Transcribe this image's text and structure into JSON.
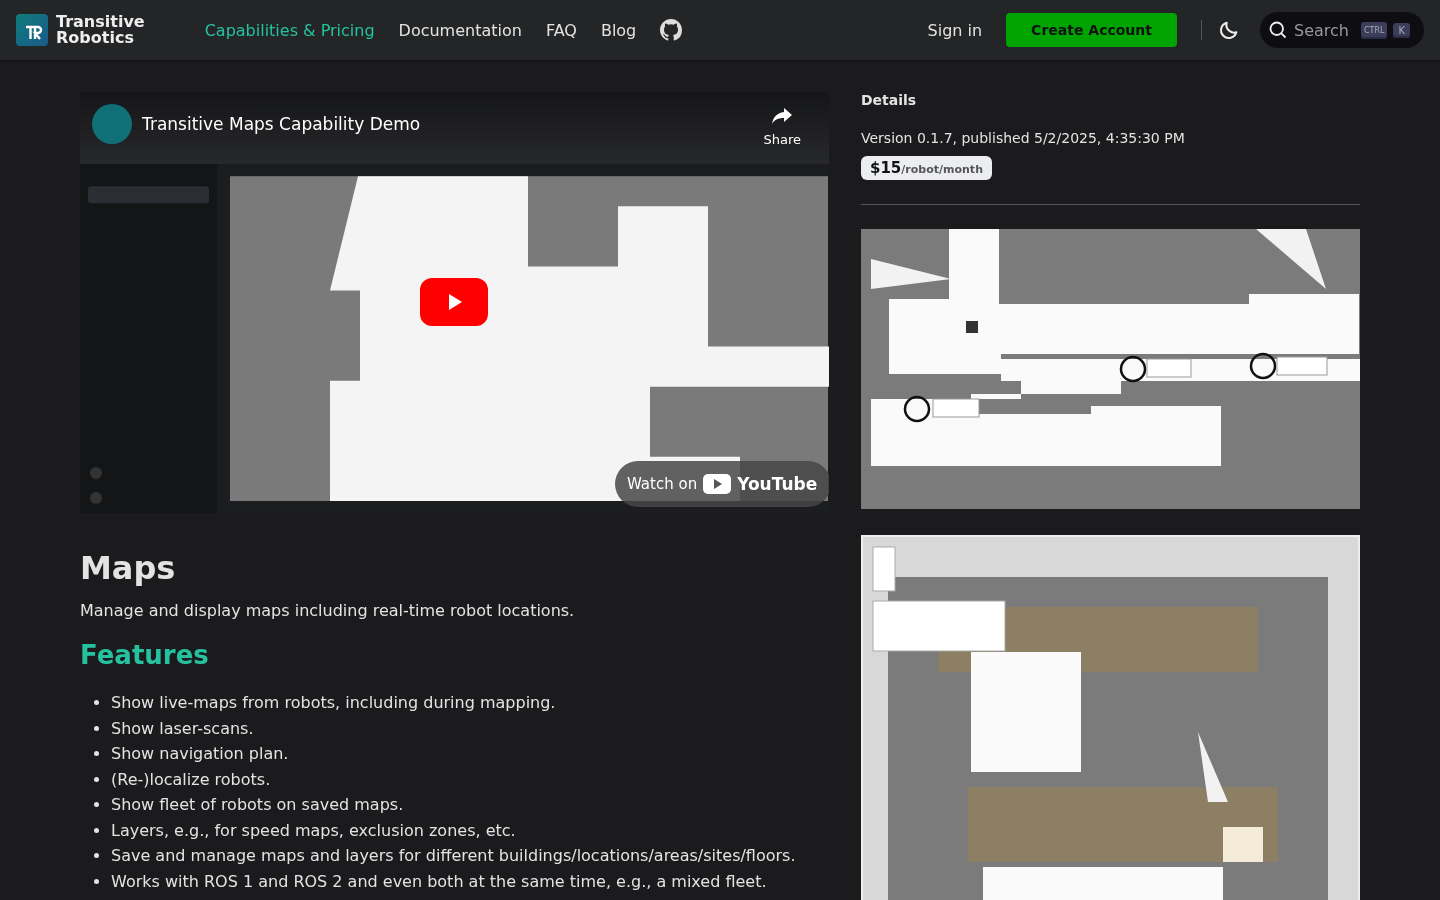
{
  "header": {
    "logo": {
      "line1": "Transitive",
      "line2": "Robotics"
    },
    "nav": [
      {
        "label": "Capabilities & Pricing",
        "selected": true
      },
      {
        "label": "Documentation",
        "selected": false
      },
      {
        "label": "FAQ",
        "selected": false
      },
      {
        "label": "Blog",
        "selected": false
      }
    ],
    "sign_in": "Sign in",
    "create_account": "Create Account",
    "search": {
      "placeholder": "Search",
      "keys": [
        "CTRL",
        "K"
      ]
    }
  },
  "video": {
    "kind": "picture",
    "title": "Transitive Maps Capability Demo",
    "share": "Share",
    "watch_on": "Watch on",
    "youtube": "YouTube"
  },
  "content": {
    "title": "Maps",
    "description": "Manage and display maps including real-time robot locations.",
    "features_heading": "Features",
    "features": [
      "Show live-maps from robots, including during mapping.",
      "Show laser-scans.",
      "Show navigation plan.",
      "(Re-)localize robots.",
      "Show fleet of robots on saved maps.",
      "Layers, e.g., for speed maps, exclusion zones, etc.",
      "Save and manage maps and layers for different buildings/locations/areas/sites/floors.",
      "Works with ROS 1 and ROS 2 and even both at the same time, e.g., a mixed fleet."
    ]
  },
  "details": {
    "heading": "Details",
    "version": "Version 0.1.7, published 5/2/2025, 4:35:30 PM",
    "price": "$15",
    "price_unit": "/robot/month"
  }
}
